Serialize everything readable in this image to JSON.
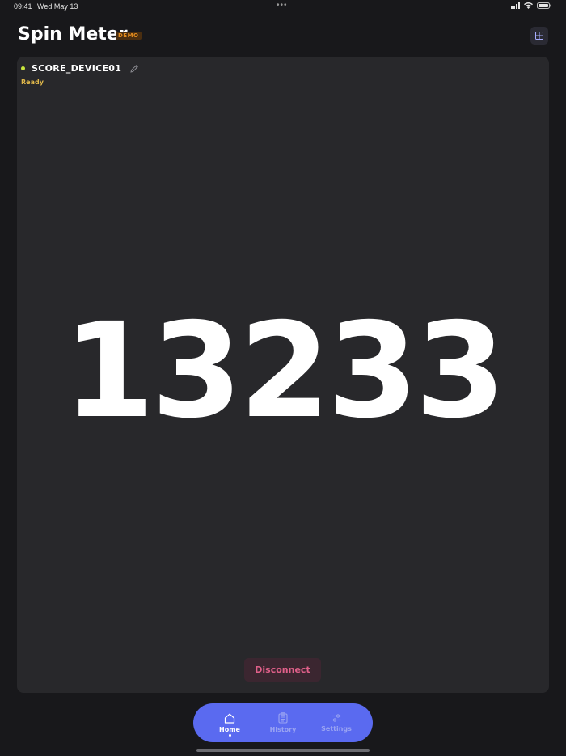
{
  "status_bar": {
    "time": "09:41",
    "date": "Wed May 13",
    "dots": "•••"
  },
  "header": {
    "title": "Spin Meter",
    "badge": "DEMO",
    "grid_icon": "grid-icon"
  },
  "device": {
    "name": "SCORE_DEVICE01",
    "status": "Ready",
    "edit_icon": "pencil-icon",
    "dot_color": "#c8e63c"
  },
  "score": {
    "value": "13233"
  },
  "actions": {
    "disconnect_label": "Disconnect"
  },
  "tabs": [
    {
      "label": "Home",
      "icon": "home-icon",
      "active": true
    },
    {
      "label": "History",
      "icon": "clipboard-icon",
      "active": false
    },
    {
      "label": "Settings",
      "icon": "sliders-icon",
      "active": false
    }
  ],
  "colors": {
    "accent": "#5a6af0",
    "background": "#18181b",
    "card": "#28282b",
    "disconnect_text": "#e0608a",
    "status_text": "#e0b84a",
    "badge_text": "#e08a1e"
  }
}
